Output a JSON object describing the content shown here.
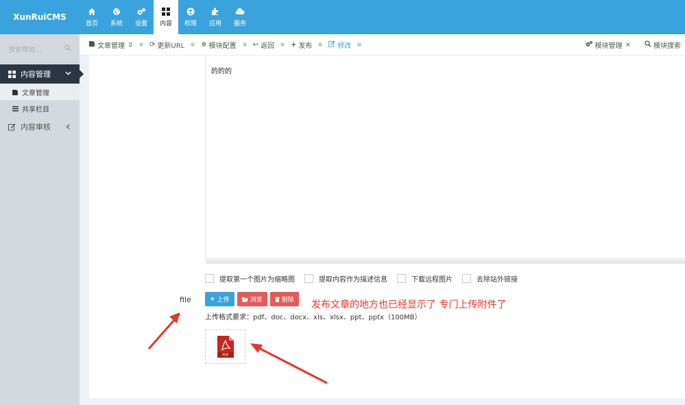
{
  "logo": {
    "text": "XunRuiCMS"
  },
  "nav": [
    {
      "label": "首页",
      "icon": "home-icon"
    },
    {
      "label": "系统",
      "icon": "globe-icon"
    },
    {
      "label": "设置",
      "icon": "gears-icon"
    },
    {
      "label": "内容",
      "icon": "grid-icon",
      "active": true
    },
    {
      "label": "权限",
      "icon": "user-icon"
    },
    {
      "label": "应用",
      "icon": "puzzle-icon"
    },
    {
      "label": "服务",
      "icon": "cloud-icon"
    }
  ],
  "sidebar": {
    "search_placeholder": "搜索帮助...",
    "group_label": "内容管理",
    "sub_items": [
      {
        "label": "文章管理",
        "selected": true
      },
      {
        "label": "共享栏目"
      }
    ],
    "review_label": "内容审核"
  },
  "toolbar": {
    "article_manage": "文章管理",
    "update_url": "更新URL",
    "module_config": "模块配置",
    "back": "返回",
    "publish": "发布",
    "edit": "修改",
    "module_manage": "模块管理",
    "module_search": "模块搜索"
  },
  "editor": {
    "text": "的的的"
  },
  "options": [
    "提取第一个图片为缩略图",
    "提取内容作为描述信息",
    "下载远程图片",
    "去除站外链接"
  ],
  "file_field": {
    "label": "file",
    "upload": "上传",
    "browse": "浏览",
    "delete": "删除",
    "format_hint": "上传格式要求：pdf、doc、docx、xls、xlsx、ppt、pptx（100MB）",
    "thumb_label": "PDF"
  },
  "annotation": "发布文章的地方也已经显示了  专门上传附件了",
  "colors": {
    "header": "#3aa3dd",
    "sidebar_dark": "#2b3643",
    "danger": "#e35b5a",
    "annotation": "#e8342a"
  }
}
